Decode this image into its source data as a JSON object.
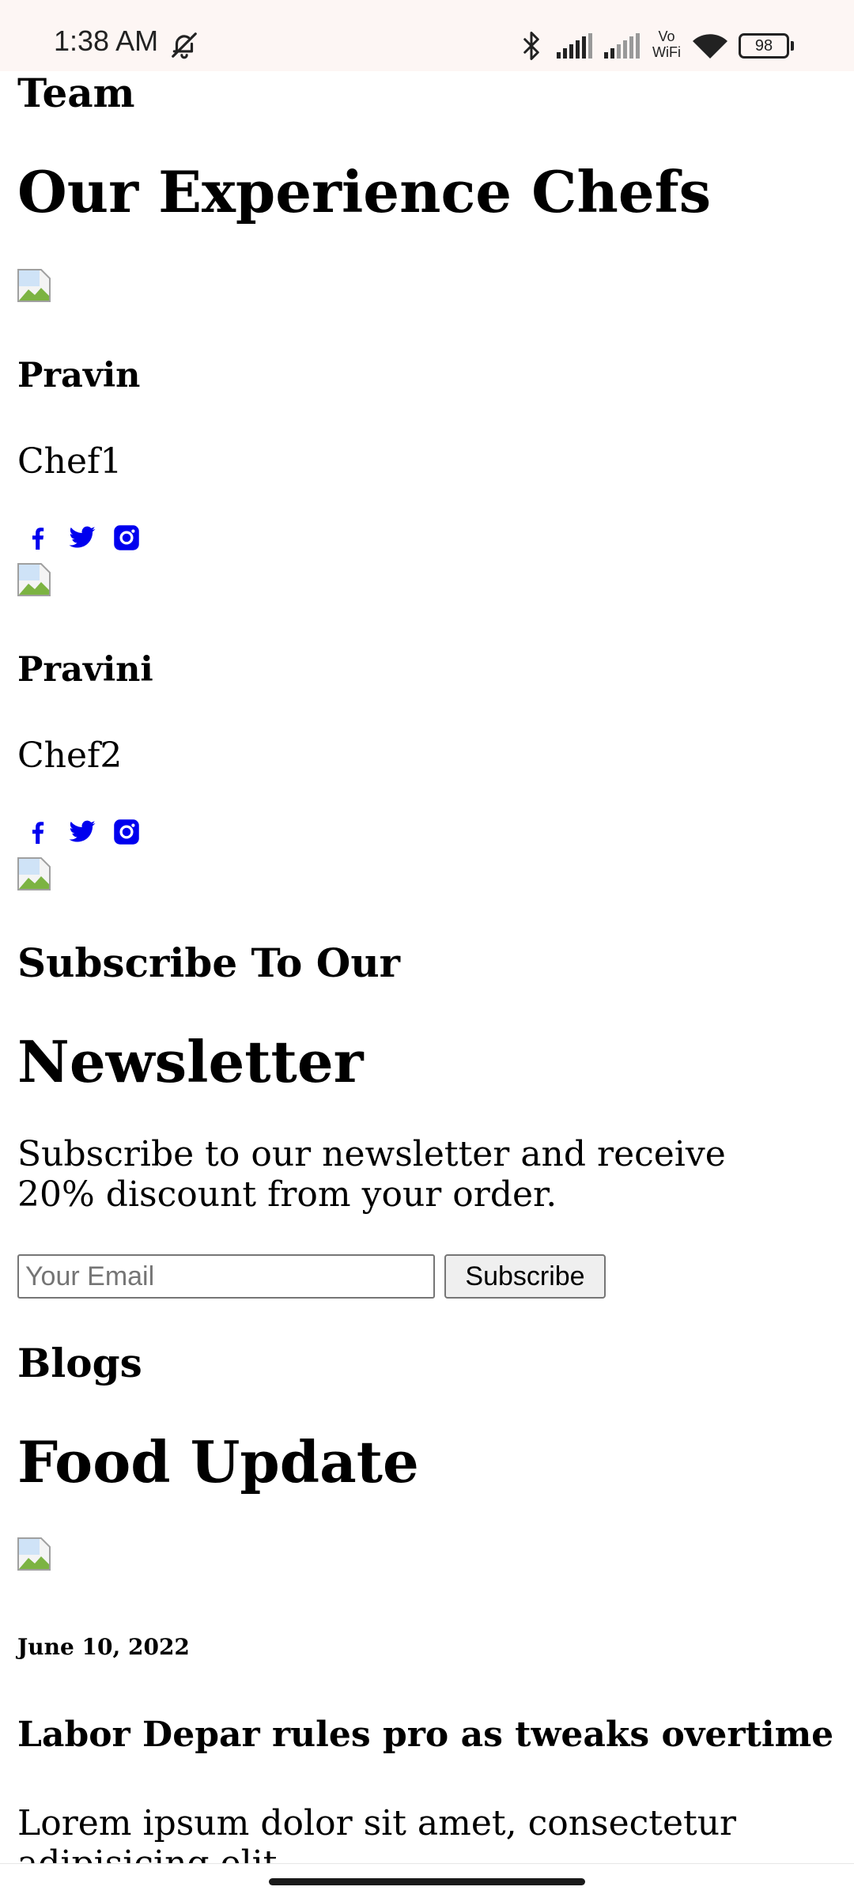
{
  "status_bar": {
    "time": "1:38 AM",
    "battery": "98",
    "icons": [
      "bell-off-icon",
      "bluetooth-icon",
      "signal-icon",
      "signal-icon",
      "vowifi-icon",
      "wifi-icon",
      "battery-icon"
    ],
    "vowifi_top": "Vo",
    "vowifi_bottom": "WiFi"
  },
  "team": {
    "section_label": "Team",
    "heading": "Our Experience Chefs",
    "chefs": [
      {
        "name": "Pravin",
        "role": "Chef1",
        "social": [
          "facebook-icon",
          "twitter-icon",
          "instagram-icon"
        ]
      },
      {
        "name": "Pravini",
        "role": "Chef2",
        "social": [
          "facebook-icon",
          "twitter-icon",
          "instagram-icon"
        ]
      }
    ]
  },
  "newsletter": {
    "heading_line1": "Subscribe To Our",
    "heading_line2": "Newsletter",
    "description": "Subscribe to our newsletter and receive 20% discount from your order.",
    "email_placeholder": "Your Email",
    "button_label": "Subscribe"
  },
  "blogs": {
    "section_label": "Blogs",
    "heading": "Food Update",
    "posts": [
      {
        "date": "June 10, 2022",
        "title": "Labor Depar rules pro as tweaks overtime",
        "excerpt": "Lorem ipsum dolor sit amet, consectetur adipisicing elit."
      }
    ]
  },
  "colors": {
    "status_bar_bg": "#fdf6f4",
    "social_icon": "#0000ee"
  }
}
